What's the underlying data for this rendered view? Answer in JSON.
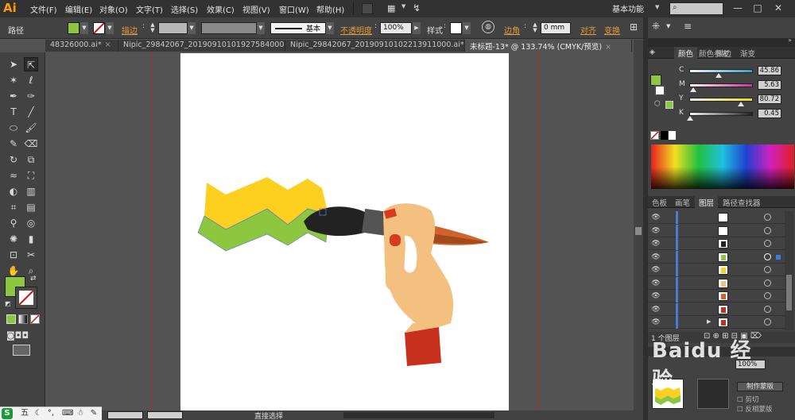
{
  "app": {
    "logo": "Ai",
    "menu": [
      "文件(F)",
      "编辑(E)",
      "对象(O)",
      "文字(T)",
      "选择(S)",
      "效果(C)",
      "视图(V)",
      "窗口(W)",
      "帮助(H)"
    ],
    "workspace": "基本功能",
    "window_buttons": [
      "—",
      "□",
      "✕"
    ]
  },
  "control_bar": {
    "selection_type": "路径",
    "stroke_label": "描边",
    "brush_label": "基本",
    "opacity_label": "不透明度",
    "opacity_value": "100%",
    "style_label": "样式",
    "corner_label": "边角",
    "corner_value": "0 mm",
    "align_label": "对齐",
    "transform_label": "变换",
    "fill_color": "#8dc63f"
  },
  "tabs": [
    {
      "label": "48326000.ai*",
      "active": false
    },
    {
      "label": "Nipic_29842067_20190910101927584000.ai*",
      "active": false
    },
    {
      "label": "Nipic_29842067_20190910102213911000.ai*",
      "active": false
    },
    {
      "label": "未标题-13* @ 133.74% (CMYK/预览)",
      "active": true
    }
  ],
  "tab_close": "×",
  "color_panel": {
    "tabs": [
      "颜色",
      "颜色参考",
      "描边",
      "渐变"
    ],
    "sliders": [
      {
        "label": "C",
        "value": "45.86",
        "fraction": 0.46,
        "color": "#3aa0c8"
      },
      {
        "label": "M",
        "value": "5.63",
        "fraction": 0.06,
        "color": "#c8369a"
      },
      {
        "label": "Y",
        "value": "80.72",
        "fraction": 0.81,
        "color": "#e8d820"
      },
      {
        "label": "K",
        "value": "0.45",
        "fraction": 0.01,
        "color": "#222222"
      }
    ],
    "fill_color": "#8dc63f"
  },
  "layers_panel": {
    "tabs": [
      "色板",
      "画笔",
      "图层",
      "路径查找器"
    ],
    "rows": [
      {
        "selected": false
      },
      {
        "selected": false
      },
      {
        "selected": false
      },
      {
        "selected": true
      },
      {
        "selected": false
      },
      {
        "selected": false
      },
      {
        "selected": false
      },
      {
        "selected": false
      },
      {
        "selected": false
      }
    ],
    "count_label": "1 个图层"
  },
  "bottom_panel": {
    "zoom_value": "100%",
    "button_label": "制作蒙版",
    "options": [
      "剪切",
      "反相蒙版"
    ]
  },
  "status": {
    "tool": "直接选择"
  },
  "watermark": "Baidu 经验"
}
